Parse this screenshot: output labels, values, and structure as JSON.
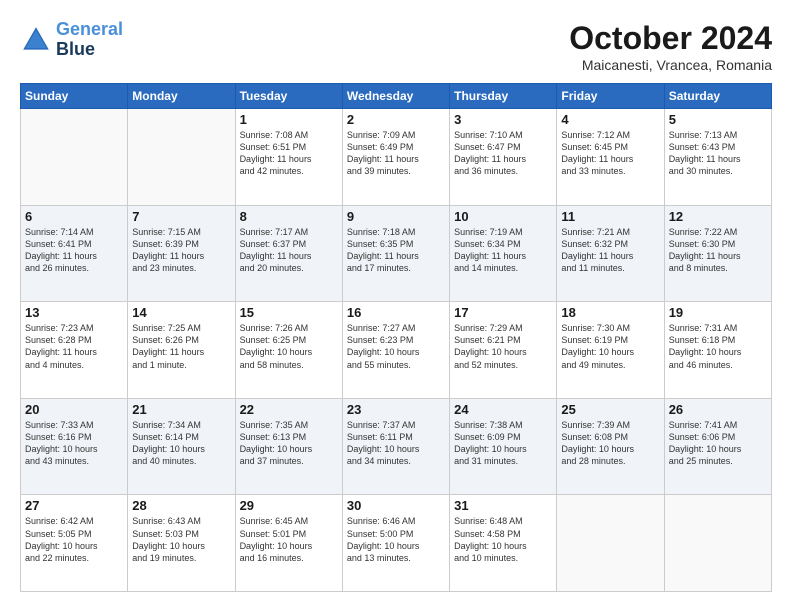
{
  "header": {
    "logo": {
      "line1": "General",
      "line2": "Blue"
    },
    "title": "October 2024",
    "location": "Maicanesti, Vrancea, Romania"
  },
  "weekdays": [
    "Sunday",
    "Monday",
    "Tuesday",
    "Wednesday",
    "Thursday",
    "Friday",
    "Saturday"
  ],
  "weeks": [
    [
      {
        "day": "",
        "info": ""
      },
      {
        "day": "",
        "info": ""
      },
      {
        "day": "1",
        "info": "Sunrise: 7:08 AM\nSunset: 6:51 PM\nDaylight: 11 hours\nand 42 minutes."
      },
      {
        "day": "2",
        "info": "Sunrise: 7:09 AM\nSunset: 6:49 PM\nDaylight: 11 hours\nand 39 minutes."
      },
      {
        "day": "3",
        "info": "Sunrise: 7:10 AM\nSunset: 6:47 PM\nDaylight: 11 hours\nand 36 minutes."
      },
      {
        "day": "4",
        "info": "Sunrise: 7:12 AM\nSunset: 6:45 PM\nDaylight: 11 hours\nand 33 minutes."
      },
      {
        "day": "5",
        "info": "Sunrise: 7:13 AM\nSunset: 6:43 PM\nDaylight: 11 hours\nand 30 minutes."
      }
    ],
    [
      {
        "day": "6",
        "info": "Sunrise: 7:14 AM\nSunset: 6:41 PM\nDaylight: 11 hours\nand 26 minutes."
      },
      {
        "day": "7",
        "info": "Sunrise: 7:15 AM\nSunset: 6:39 PM\nDaylight: 11 hours\nand 23 minutes."
      },
      {
        "day": "8",
        "info": "Sunrise: 7:17 AM\nSunset: 6:37 PM\nDaylight: 11 hours\nand 20 minutes."
      },
      {
        "day": "9",
        "info": "Sunrise: 7:18 AM\nSunset: 6:35 PM\nDaylight: 11 hours\nand 17 minutes."
      },
      {
        "day": "10",
        "info": "Sunrise: 7:19 AM\nSunset: 6:34 PM\nDaylight: 11 hours\nand 14 minutes."
      },
      {
        "day": "11",
        "info": "Sunrise: 7:21 AM\nSunset: 6:32 PM\nDaylight: 11 hours\nand 11 minutes."
      },
      {
        "day": "12",
        "info": "Sunrise: 7:22 AM\nSunset: 6:30 PM\nDaylight: 11 hours\nand 8 minutes."
      }
    ],
    [
      {
        "day": "13",
        "info": "Sunrise: 7:23 AM\nSunset: 6:28 PM\nDaylight: 11 hours\nand 4 minutes."
      },
      {
        "day": "14",
        "info": "Sunrise: 7:25 AM\nSunset: 6:26 PM\nDaylight: 11 hours\nand 1 minute."
      },
      {
        "day": "15",
        "info": "Sunrise: 7:26 AM\nSunset: 6:25 PM\nDaylight: 10 hours\nand 58 minutes."
      },
      {
        "day": "16",
        "info": "Sunrise: 7:27 AM\nSunset: 6:23 PM\nDaylight: 10 hours\nand 55 minutes."
      },
      {
        "day": "17",
        "info": "Sunrise: 7:29 AM\nSunset: 6:21 PM\nDaylight: 10 hours\nand 52 minutes."
      },
      {
        "day": "18",
        "info": "Sunrise: 7:30 AM\nSunset: 6:19 PM\nDaylight: 10 hours\nand 49 minutes."
      },
      {
        "day": "19",
        "info": "Sunrise: 7:31 AM\nSunset: 6:18 PM\nDaylight: 10 hours\nand 46 minutes."
      }
    ],
    [
      {
        "day": "20",
        "info": "Sunrise: 7:33 AM\nSunset: 6:16 PM\nDaylight: 10 hours\nand 43 minutes."
      },
      {
        "day": "21",
        "info": "Sunrise: 7:34 AM\nSunset: 6:14 PM\nDaylight: 10 hours\nand 40 minutes."
      },
      {
        "day": "22",
        "info": "Sunrise: 7:35 AM\nSunset: 6:13 PM\nDaylight: 10 hours\nand 37 minutes."
      },
      {
        "day": "23",
        "info": "Sunrise: 7:37 AM\nSunset: 6:11 PM\nDaylight: 10 hours\nand 34 minutes."
      },
      {
        "day": "24",
        "info": "Sunrise: 7:38 AM\nSunset: 6:09 PM\nDaylight: 10 hours\nand 31 minutes."
      },
      {
        "day": "25",
        "info": "Sunrise: 7:39 AM\nSunset: 6:08 PM\nDaylight: 10 hours\nand 28 minutes."
      },
      {
        "day": "26",
        "info": "Sunrise: 7:41 AM\nSunset: 6:06 PM\nDaylight: 10 hours\nand 25 minutes."
      }
    ],
    [
      {
        "day": "27",
        "info": "Sunrise: 6:42 AM\nSunset: 5:05 PM\nDaylight: 10 hours\nand 22 minutes."
      },
      {
        "day": "28",
        "info": "Sunrise: 6:43 AM\nSunset: 5:03 PM\nDaylight: 10 hours\nand 19 minutes."
      },
      {
        "day": "29",
        "info": "Sunrise: 6:45 AM\nSunset: 5:01 PM\nDaylight: 10 hours\nand 16 minutes."
      },
      {
        "day": "30",
        "info": "Sunrise: 6:46 AM\nSunset: 5:00 PM\nDaylight: 10 hours\nand 13 minutes."
      },
      {
        "day": "31",
        "info": "Sunrise: 6:48 AM\nSunset: 4:58 PM\nDaylight: 10 hours\nand 10 minutes."
      },
      {
        "day": "",
        "info": ""
      },
      {
        "day": "",
        "info": ""
      }
    ]
  ]
}
